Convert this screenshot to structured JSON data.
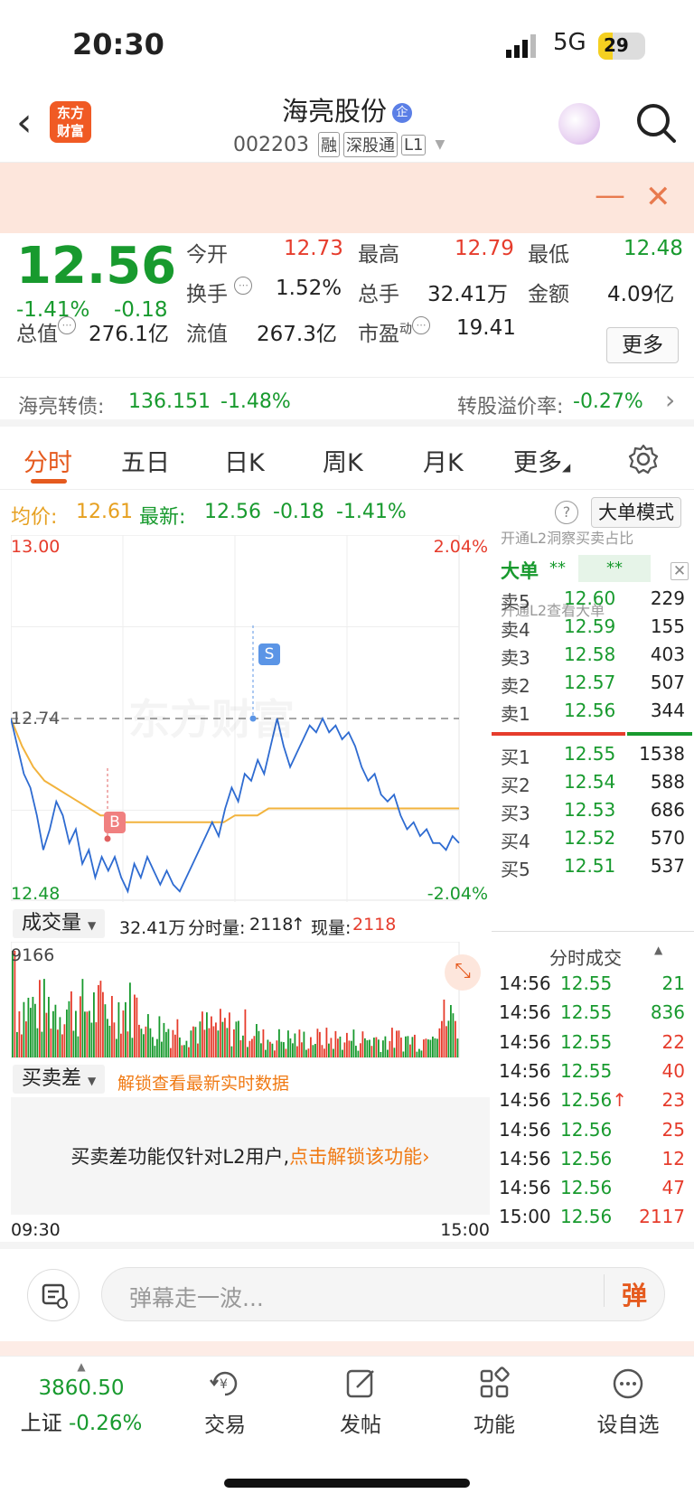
{
  "status": {
    "time": "20:30",
    "network": "5G",
    "battery": "29"
  },
  "header": {
    "name": "海亮股份",
    "badge": "企",
    "code": "002203",
    "tags": [
      "融",
      "深股通",
      "L1"
    ]
  },
  "quote": {
    "price": "12.56",
    "pct": "-1.41%",
    "change": "-0.18",
    "open_label": "今开",
    "open": "12.73",
    "high_label": "最高",
    "high": "12.79",
    "low_label": "最低",
    "low": "12.48",
    "turnover_label": "换手",
    "turnover": "1.52%",
    "volume_label": "总手",
    "volume": "32.41万",
    "amount_label": "金额",
    "amount": "4.09亿",
    "mcap_label": "总值",
    "mcap": "276.1亿",
    "float_label": "流值",
    "float": "267.3亿",
    "pe_label": "市盈",
    "pe_sup": "动",
    "pe": "19.41",
    "more": "更多"
  },
  "bond": {
    "label": "海亮转债:",
    "price": "136.151",
    "pct": "-1.48%",
    "premium_label": "转股溢价率:",
    "premium": "-0.27%"
  },
  "tabs": [
    "分时",
    "五日",
    "日K",
    "周K",
    "月K",
    "更多"
  ],
  "avgline": {
    "avg_label": "均价:",
    "avg": "12.61",
    "latest_label": "最新:",
    "latest": "12.56",
    "chg": "-0.18",
    "pct": "-1.41%",
    "mode": "大单模式"
  },
  "chart": {
    "ymax": "13.00",
    "ymin": "12.48",
    "pmax": "2.04%",
    "pmin": "-2.04%",
    "prev_close": "12.74",
    "marker_s": "S",
    "marker_b": "B",
    "watermark": "东方财富",
    "price_series": [
      12.74,
      12.7,
      12.66,
      12.64,
      12.6,
      12.55,
      12.58,
      12.62,
      12.6,
      12.56,
      12.58,
      12.53,
      12.55,
      12.51,
      12.54,
      12.52,
      12.54,
      12.51,
      12.49,
      12.53,
      12.51,
      12.54,
      12.52,
      12.5,
      12.52,
      12.5,
      12.49,
      12.51,
      12.53,
      12.55,
      12.57,
      12.59,
      12.57,
      12.61,
      12.64,
      12.62,
      12.66,
      12.65,
      12.68,
      12.66,
      12.7,
      12.74,
      12.7,
      12.67,
      12.69,
      12.71,
      12.73,
      12.72,
      12.74,
      12.72,
      12.73,
      12.71,
      12.72,
      12.7,
      12.67,
      12.65,
      12.66,
      12.63,
      12.62,
      12.63,
      12.6,
      12.58,
      12.59,
      12.57,
      12.58,
      12.56,
      12.56,
      12.55,
      12.57,
      12.56
    ],
    "avg_series": [
      12.74,
      12.7,
      12.67,
      12.65,
      12.64,
      12.63,
      12.62,
      12.61,
      12.6,
      12.6,
      12.59,
      12.59,
      12.59,
      12.59,
      12.59,
      12.59,
      12.59,
      12.59,
      12.59,
      12.59,
      12.6,
      12.6,
      12.6,
      12.61,
      12.61,
      12.61,
      12.61,
      12.61,
      12.61,
      12.61,
      12.61,
      12.61,
      12.61,
      12.61,
      12.61,
      12.61,
      12.61,
      12.61,
      12.61,
      12.61,
      12.61
    ]
  },
  "volume": {
    "dropdown": "成交量",
    "total": "32.41万",
    "minute_label": "分时量:",
    "minute": "2118",
    "arrow": "↑",
    "now_label": "现量:",
    "now": "2118",
    "max": "9166"
  },
  "bs": {
    "dropdown": "买卖差",
    "link": "解锁查看最新实时数据",
    "msg": "买卖差功能仅针对L2用户,",
    "unlock": "点击解锁该功能›"
  },
  "times": {
    "start": "09:30",
    "end": "15:00"
  },
  "right": {
    "promo1": "开通L2洞察买卖占比",
    "bigorder": "大单",
    "stars1": "**",
    "stars2": "**",
    "promo2": "开通L2查看大单",
    "asks": [
      [
        "卖5",
        "12.60",
        "229"
      ],
      [
        "卖4",
        "12.59",
        "155"
      ],
      [
        "卖3",
        "12.58",
        "403"
      ],
      [
        "卖2",
        "12.57",
        "507"
      ],
      [
        "卖1",
        "12.56",
        "344"
      ]
    ],
    "bids": [
      [
        "买1",
        "12.55",
        "1538"
      ],
      [
        "买2",
        "12.54",
        "588"
      ],
      [
        "买3",
        "12.53",
        "686"
      ],
      [
        "买4",
        "12.52",
        "570"
      ],
      [
        "买5",
        "12.51",
        "537"
      ]
    ],
    "ticks_title": "分时成交",
    "ticks": [
      [
        "14:56",
        "12.55",
        "21",
        "g"
      ],
      [
        "14:56",
        "12.55",
        "836",
        "g"
      ],
      [
        "14:56",
        "12.55",
        "22",
        "r"
      ],
      [
        "14:56",
        "12.55",
        "40",
        "r"
      ],
      [
        "14:56",
        "12.56↑",
        "23",
        "r"
      ],
      [
        "14:56",
        "12.56",
        "25",
        "r"
      ],
      [
        "14:56",
        "12.56",
        "12",
        "r"
      ],
      [
        "14:56",
        "12.56",
        "47",
        "r"
      ],
      [
        "15:00",
        "12.56",
        "2117",
        "r"
      ]
    ]
  },
  "comment": {
    "placeholder": "弹幕走一波...",
    "btn": "弹"
  },
  "nav": {
    "index_value": "3860.50",
    "index_name": "上证",
    "index_pct": "-0.26%",
    "items": [
      "交易",
      "发帖",
      "功能",
      "设自选"
    ]
  }
}
